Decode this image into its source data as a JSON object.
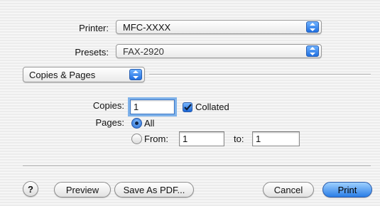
{
  "printer": {
    "label": "Printer:",
    "value": "MFC-XXXX"
  },
  "presets": {
    "label": "Presets:",
    "value": "FAX-2920"
  },
  "section_popup": {
    "value": "Copies & Pages"
  },
  "copies": {
    "label": "Copies:",
    "value": "1",
    "collated_label": "Collated",
    "collated_checked": true
  },
  "pages": {
    "label": "Pages:",
    "all_label": "All",
    "from_label": "From:",
    "from_value": "1",
    "to_label": "to:",
    "to_value": "1",
    "selected": "All"
  },
  "footer": {
    "help": "?",
    "preview": "Preview",
    "save_as_pdf": "Save As PDF...",
    "cancel": "Cancel",
    "print": "Print"
  },
  "icons": {
    "popup_arrows": "up-down-arrows-icon",
    "checkmark": "checkmark-icon",
    "help": "question-mark-icon"
  },
  "colors": {
    "accent": "#2a7ee6",
    "focus_ring": "#7fb2ea"
  }
}
